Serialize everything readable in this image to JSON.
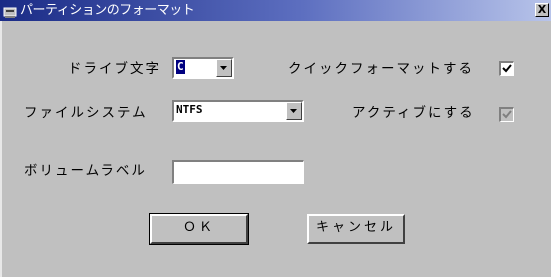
{
  "window": {
    "title": "パーティションのフォーマット",
    "close_label": "X",
    "title_icon": "disk-format-icon"
  },
  "form": {
    "drive_letter": {
      "label": "ドライブ文字",
      "value": "C"
    },
    "file_system": {
      "label": "ファイルシステム",
      "value": "NTFS"
    },
    "volume_label": {
      "label": "ボリュームラベル",
      "value": ""
    },
    "quick_format": {
      "label": "クイックフォーマットする",
      "checked": true
    },
    "set_active": {
      "label": "アクティブにする",
      "checked": true,
      "disabled": true
    }
  },
  "buttons": {
    "ok": "ＯＫ",
    "cancel": "キャンセル"
  },
  "colors": {
    "titlebar_start": "#1a2b86",
    "titlebar_end": "#b8c4ea",
    "face": "#c0c0c0",
    "selection": "#000080"
  }
}
